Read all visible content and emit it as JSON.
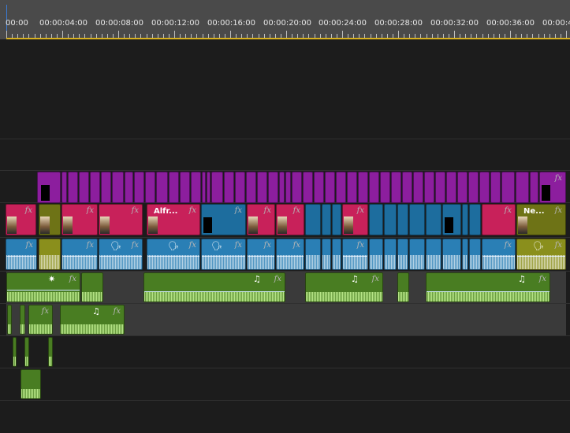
{
  "ruler": {
    "labels": [
      "00:00",
      "00:00:04:00",
      "00:00:08:00",
      "00:00:12:00",
      "00:00:16:00",
      "00:00:20:00",
      "00:00:24:00",
      "00:00:28:00",
      "00:00:32:00",
      "00:00:36:00",
      "00:00:40:0"
    ]
  },
  "clips": {
    "fx": "fx",
    "alfr": "Alfr...",
    "ne": "Ne...",
    "music": "♫",
    "speech": "🗣",
    "star": "✷"
  },
  "colors": {
    "title_track": "#8c1e9e",
    "video_pink": "#c8215a",
    "video_blue": "#1d6d9e",
    "video_olive": "#6e7316",
    "audio_blue": "#2a7fb5",
    "audio_green": "#497d22"
  }
}
